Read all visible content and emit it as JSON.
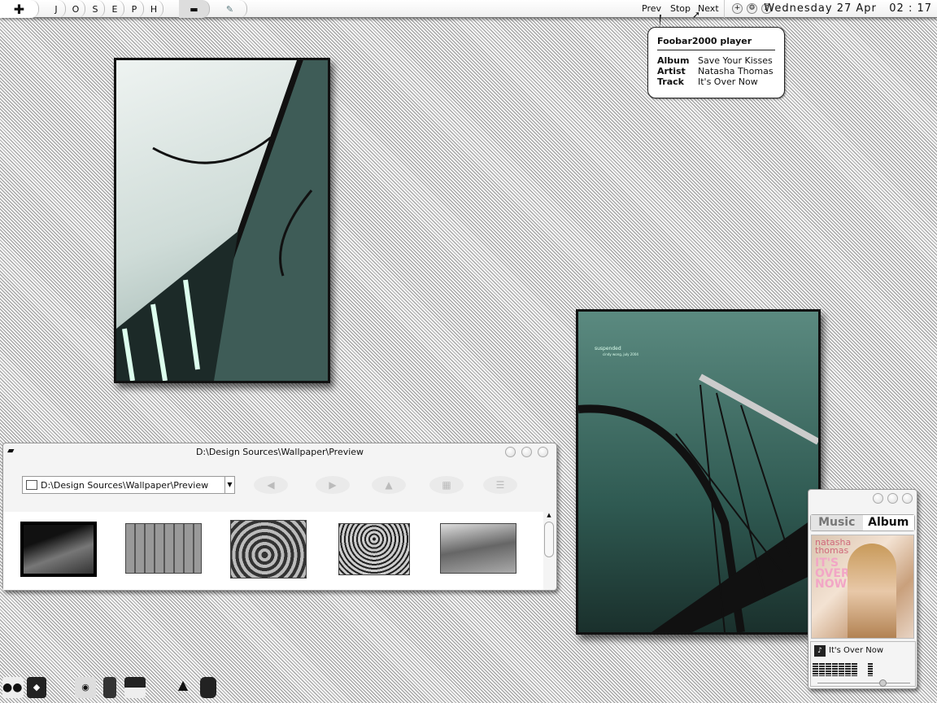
{
  "topbar": {
    "letters": [
      "J",
      "O",
      "S",
      "E",
      "P",
      "H"
    ],
    "controls": {
      "prev": "Prev",
      "stop": "Stop",
      "next": "Next"
    },
    "date": "Wednesday 27 Apr",
    "time": "02 : 17"
  },
  "tooltip": {
    "title": "Foobar2000 player",
    "rows": [
      {
        "label": "Album",
        "value": "Save Your Kisses"
      },
      {
        "label": "Artist",
        "value": "Natasha Thomas"
      },
      {
        "label": "Track",
        "value": "It's Over Now"
      }
    ]
  },
  "photo2": {
    "caption": "suspended",
    "subcaption": "cindy wong, july 2004"
  },
  "explorer": {
    "title": "D:\\Design Sources\\Wallpaper\\Preview",
    "address": "D:\\Design Sources\\Wallpaper\\Preview",
    "thumb_count": 5
  },
  "music": {
    "tabs": [
      "Music",
      "Album"
    ],
    "active_tab": "Album",
    "cover_artist": "natasha thomas",
    "cover_title": "IT'S OVER NOW",
    "track": "It's Over Now",
    "volume": 0.7
  },
  "colors": {
    "bg_stripe": "#9a9a9a",
    "panel": "#f4f4f4",
    "photo_teal": "#2f5a52"
  }
}
